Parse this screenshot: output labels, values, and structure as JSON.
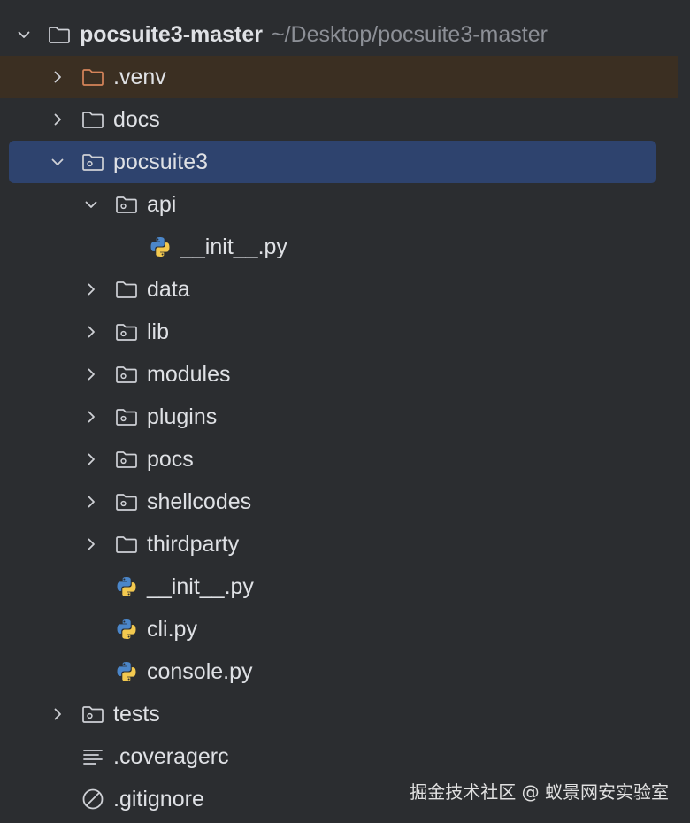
{
  "colors": {
    "background": "#2b2d30",
    "selected_row": "#2e436e",
    "venv_row": "#3b2f22",
    "text": "#dfe1e5",
    "muted_text": "#8c8f96",
    "icon_stroke": "#cfd1d6",
    "venv_folder": "#d6845a",
    "python_blue": "#4b86c9",
    "python_yellow": "#f3c94f"
  },
  "project": {
    "name": "pocsuite3-master",
    "path": "~/Desktop/pocsuite3-master"
  },
  "tree": [
    {
      "label": "pocsuite3-master",
      "icon": "folder-icon",
      "expanded": true,
      "level": 0
    },
    {
      "label": ".venv",
      "icon": "venv-folder-icon",
      "expanded": false,
      "level": 1,
      "excluded": true
    },
    {
      "label": "docs",
      "icon": "folder-icon",
      "expanded": false,
      "level": 1
    },
    {
      "label": "pocsuite3",
      "icon": "package-folder-icon",
      "expanded": true,
      "level": 1,
      "selected": true
    },
    {
      "label": "api",
      "icon": "package-folder-icon",
      "expanded": true,
      "level": 2
    },
    {
      "label": "__init__.py",
      "icon": "python-file-icon",
      "level": 3
    },
    {
      "label": "data",
      "icon": "folder-icon",
      "expanded": false,
      "level": 2
    },
    {
      "label": "lib",
      "icon": "package-folder-icon",
      "expanded": false,
      "level": 2
    },
    {
      "label": "modules",
      "icon": "package-folder-icon",
      "expanded": false,
      "level": 2
    },
    {
      "label": "plugins",
      "icon": "package-folder-icon",
      "expanded": false,
      "level": 2
    },
    {
      "label": "pocs",
      "icon": "package-folder-icon",
      "expanded": false,
      "level": 2
    },
    {
      "label": "shellcodes",
      "icon": "package-folder-icon",
      "expanded": false,
      "level": 2
    },
    {
      "label": "thirdparty",
      "icon": "folder-icon",
      "expanded": false,
      "level": 2
    },
    {
      "label": "__init__.py",
      "icon": "python-file-icon",
      "level": 2
    },
    {
      "label": "cli.py",
      "icon": "python-file-icon",
      "level": 2
    },
    {
      "label": "console.py",
      "icon": "python-file-icon",
      "level": 2
    },
    {
      "label": "tests",
      "icon": "package-folder-icon",
      "expanded": false,
      "level": 1
    },
    {
      "label": ".coveragerc",
      "icon": "text-file-icon",
      "level": 1
    },
    {
      "label": ".gitignore",
      "icon": "ignore-file-icon",
      "level": 1
    }
  ],
  "watermark": "掘金技术社区 @ 蚁景网安实验室"
}
